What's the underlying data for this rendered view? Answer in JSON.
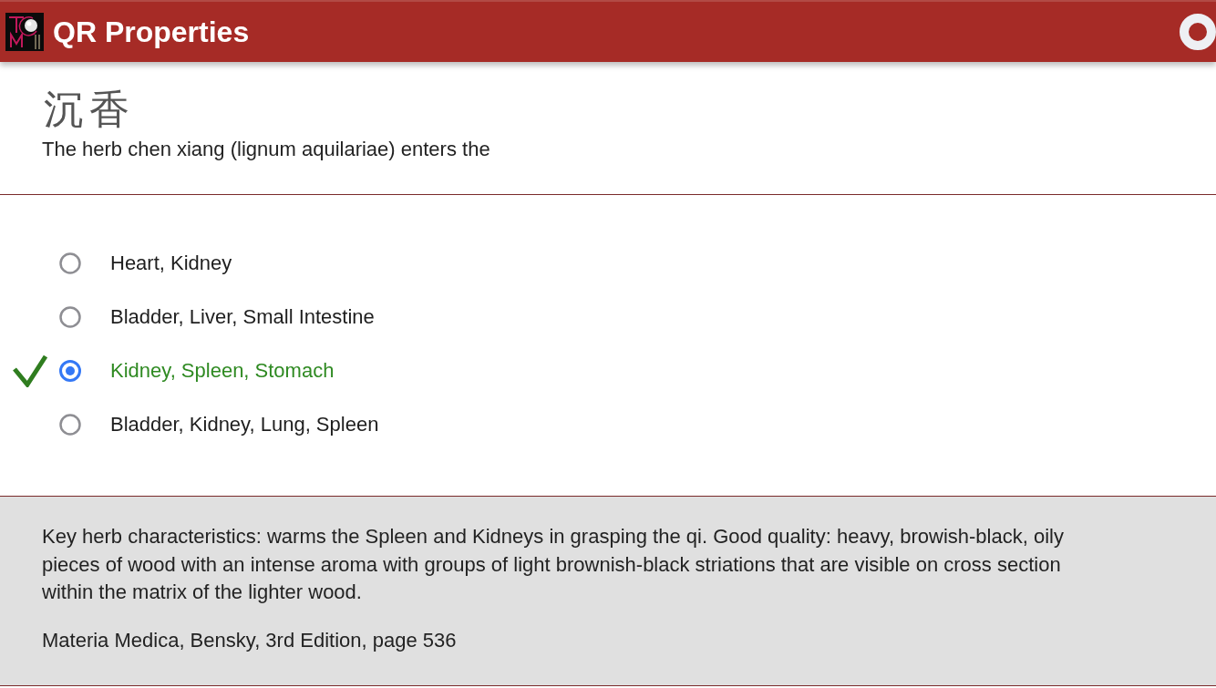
{
  "header": {
    "title": "QR Properties"
  },
  "question": {
    "characters": "沉香",
    "text": "The herb chen xiang (lignum aquilariae) enters the"
  },
  "options": [
    {
      "label": "Heart, Kidney",
      "selected": false,
      "correct": false
    },
    {
      "label": "Bladder, Liver, Small Intestine",
      "selected": false,
      "correct": false
    },
    {
      "label": "Kidney, Spleen, Stomach",
      "selected": true,
      "correct": true
    },
    {
      "label": "Bladder, Kidney, Lung, Spleen",
      "selected": false,
      "correct": false
    }
  ],
  "explanation": {
    "text": "Key herb characteristics: warms the Spleen and Kidneys in grasping the qi. Good quality: heavy, browish-black, oily pieces of wood with an intense aroma with groups of light brownish-black striations that are visible on cross section within the matrix of the lighter wood.",
    "source": "Materia Medica, Bensky, 3rd Edition, page 536"
  }
}
